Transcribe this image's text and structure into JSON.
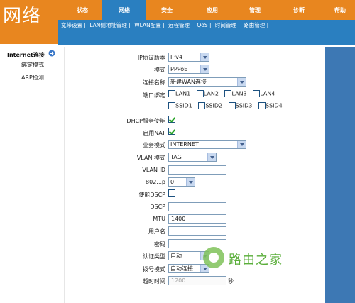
{
  "header": {
    "logo": "网络",
    "tabs": [
      "状态",
      "网络",
      "安全",
      "应用",
      "管理",
      "诊断",
      "帮助"
    ],
    "active_tab": 1
  },
  "subnav": {
    "items": [
      "宽带设置 |",
      "LAN侧地址管理 |",
      "WLAN配置 |",
      "远程管理 |",
      "QoS |",
      "时间管理 |",
      "路由管理 |"
    ]
  },
  "sidebar": {
    "items": [
      "Internet连接",
      "绑定模式",
      "ARP检测"
    ]
  },
  "form": {
    "ip_version": {
      "label": "IP协议版本",
      "value": "IPv4"
    },
    "mode": {
      "label": "模式",
      "value": "PPPoE"
    },
    "connection_name": {
      "label": "连接名称",
      "value": "新建WAN连接"
    },
    "port_binding": {
      "label": "端口绑定",
      "row1": [
        "LAN1",
        "LAN2",
        "LAN3",
        "LAN4"
      ],
      "row2": [
        "SSID1",
        "SSID2",
        "SSID3",
        "SSID4"
      ]
    },
    "dhcp": {
      "label": "DHCP服务使能",
      "checked": true
    },
    "nat": {
      "label": "启用NAT",
      "checked": true
    },
    "service_mode": {
      "label": "业务模式",
      "value": "INTERNET"
    },
    "vlan_mode": {
      "label": "VLAN 模式",
      "value": "TAG"
    },
    "vlan_id": {
      "label": "VLAN ID",
      "value": ""
    },
    "dot1p": {
      "label": "802.1p",
      "value": "0"
    },
    "dscp_enable": {
      "label": "使能DSCP",
      "checked": false
    },
    "dscp": {
      "label": "DSCP",
      "value": ""
    },
    "mtu": {
      "label": "MTU",
      "value": "1400"
    },
    "username": {
      "label": "用户名",
      "value": ""
    },
    "password": {
      "label": "密码",
      "value": ""
    },
    "auth_type": {
      "label": "认证类型",
      "value": "自动"
    },
    "dial_mode": {
      "label": "拨号模式",
      "value": "自动连接"
    },
    "timeout": {
      "label": "超时时间",
      "value": "1200",
      "unit": "秒"
    }
  },
  "watermark": {
    "text": "路由之家"
  },
  "colors": {
    "orange": "#e8861f",
    "blue": "#2a7fc0",
    "panel_blue": "#3d78b4"
  }
}
